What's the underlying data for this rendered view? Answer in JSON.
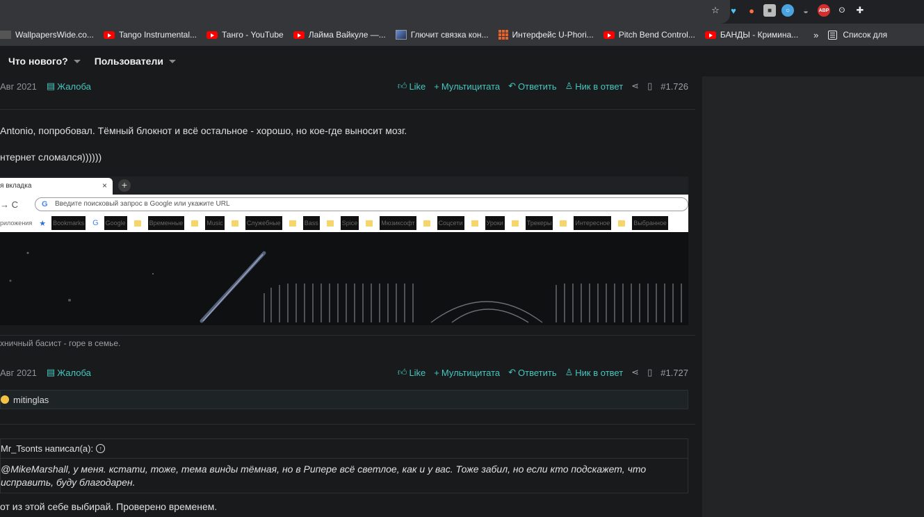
{
  "bookmarks": [
    {
      "icon": "wallpaperswide-icon",
      "label": "WallpapersWide.co..."
    },
    {
      "icon": "youtube-icon",
      "label": "Tango Instrumental..."
    },
    {
      "icon": "youtube-icon",
      "label": "Танго - YouTube"
    },
    {
      "icon": "youtube-icon",
      "label": "Лайма Вайкуле —..."
    },
    {
      "icon": "image-icon",
      "label": "Глючит связка кон..."
    },
    {
      "icon": "uphoria-icon",
      "label": "Интерфейс U-Phori..."
    },
    {
      "icon": "youtube-icon",
      "label": "Pitch Bend Control..."
    },
    {
      "icon": "youtube-icon",
      "label": "БАНДЫ - Кримина..."
    }
  ],
  "bookmarks_more": "»",
  "reading_list": "Список для",
  "nav": {
    "whats_new": "Что нового?",
    "users": "Пользователи"
  },
  "post1": {
    "date": "Авг 2021",
    "report": "Жалоба",
    "like": "Like",
    "multiquote": "Мультицитата",
    "reply": "Ответить",
    "nick_reply": "Ник в ответ",
    "number": "#1.726",
    "line1": "Antonio, попробовал. Тёмный блокнот и всё остальное - хорошо, но кое-где выносит мозг.",
    "line2": "нтернет сломался))))))",
    "signature": "хничный басист - горе в семье."
  },
  "embedded_browser": {
    "tab_label": "я вкладка",
    "tab_close": "×",
    "new_tab": "+",
    "nav": "→  C",
    "google": "G",
    "omnibox_placeholder": "Введите поисковый запрос в Google или укажите URL",
    "bookmarks": [
      "риложения",
      "Bookmarks",
      "Google",
      "Временные",
      "Music",
      "Служебные",
      "Bass",
      "Spice",
      "Мюзиксофт",
      "Соцсети",
      "Уроки",
      "Трекеры",
      "Интересное",
      "Выбранное"
    ]
  },
  "post2": {
    "date": "Авг 2021",
    "report": "Жалоба",
    "like": "Like",
    "multiquote": "Мультицитата",
    "reply": "Ответить",
    "nick_reply": "Ник в ответ",
    "number": "#1.727",
    "reaction_user": "mitinglas",
    "quote_author": "Mr_Tsonts написал(а):",
    "quote_mention": "@MikeMarshall",
    "quote_text": ", у меня. кстати, тоже, тема винды тёмная, но в Рипере всё светлое, как и у вас. Тоже забил, но если кто подскажет, что исправить, буду благодарен.",
    "body": "от из этой себе выбирай. Проверено временем."
  }
}
